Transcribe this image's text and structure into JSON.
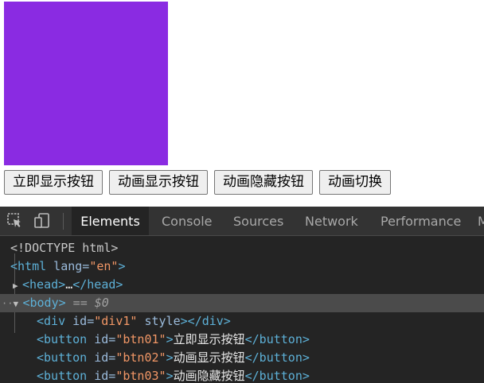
{
  "page": {
    "box_color": "#8a2be2",
    "buttons": [
      {
        "label": "立即显示按钮"
      },
      {
        "label": "动画显示按钮"
      },
      {
        "label": "动画隐藏按钮"
      },
      {
        "label": "动画切换"
      }
    ]
  },
  "devtools": {
    "icons": [
      "inspect-element-icon",
      "device-toggle-icon"
    ],
    "tabs": [
      {
        "label": "Elements",
        "active": true
      },
      {
        "label": "Console",
        "active": false
      },
      {
        "label": "Sources",
        "active": false
      },
      {
        "label": "Network",
        "active": false
      },
      {
        "label": "Performance",
        "active": false
      },
      {
        "label": "M",
        "active": false
      }
    ],
    "dom": {
      "doctype": "<!DOCTYPE html>",
      "html_open": "<html",
      "html_attr": " lang=",
      "html_val": "\"en\"",
      "html_close": ">",
      "head_open": "<head>",
      "head_ellipsis": "…",
      "head_close": "</head>",
      "body_open": "<body>",
      "body_sel": " == $0",
      "div_open": "<div",
      "div_attr": " id=",
      "div_val": "\"div1\"",
      "div_attr2": " style",
      "div_close": "></div>",
      "btn1_open": "<button",
      "btn1_attr": " id=",
      "btn1_val": "\"btn01\"",
      "btn1_gt": ">",
      "btn1_text": "立即显示按钮",
      "btn1_close": "</button>",
      "btn2_open": "<button",
      "btn2_attr": " id=",
      "btn2_val": "\"btn02\"",
      "btn2_gt": ">",
      "btn2_text": "动画显示按钮",
      "btn2_close": "</button>",
      "btn3_open": "<button",
      "btn3_attr": " id=",
      "btn3_val": "\"btn03\"",
      "btn3_gt": ">",
      "btn3_text": "动画隐藏按钮",
      "btn3_close": "</button>"
    }
  }
}
